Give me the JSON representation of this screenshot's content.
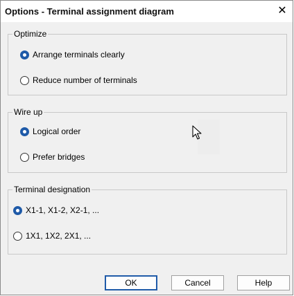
{
  "window": {
    "title": "Options - Terminal assignment diagram",
    "close_icon": "close-icon"
  },
  "groups": {
    "optimize": {
      "legend": "Optimize",
      "options": [
        {
          "label": "Arrange terminals clearly",
          "checked": true
        },
        {
          "label": "Reduce number of terminals",
          "checked": false
        }
      ]
    },
    "wire_up": {
      "legend": "Wire up",
      "options": [
        {
          "label": "Logical order",
          "checked": true
        },
        {
          "label": "Prefer bridges",
          "checked": false
        }
      ]
    },
    "terminal_designation": {
      "legend": "Terminal designation",
      "options": [
        {
          "label": "X1-1,  X1-2,  X2-1,  ...",
          "checked": true
        },
        {
          "label": "1X1,  1X2,  2X1,  ...",
          "checked": false
        }
      ]
    }
  },
  "buttons": {
    "ok": "OK",
    "cancel": "Cancel",
    "help": "Help"
  },
  "colors": {
    "accent": "#1f5aa8",
    "dialog_bg": "#f0f0f0"
  }
}
